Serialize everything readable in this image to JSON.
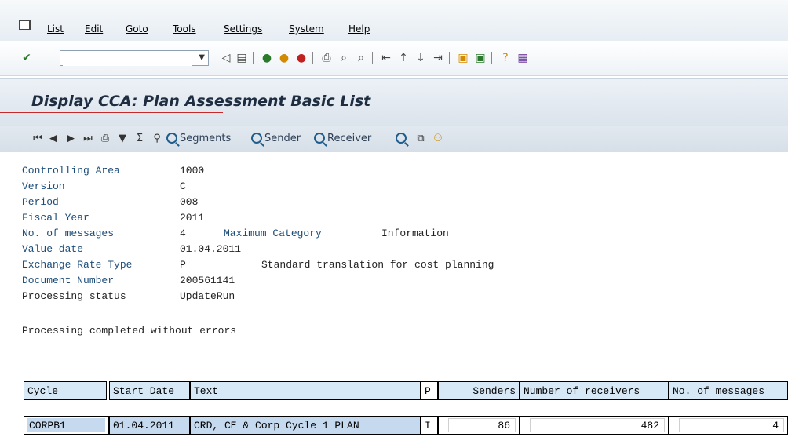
{
  "menubar": {
    "items": [
      "List",
      "Edit",
      "Goto",
      "Tools",
      "Settings",
      "System",
      "Help"
    ]
  },
  "toolbar": {
    "command_value": "",
    "icons": [
      "enter-icon",
      "back-icon",
      "save-icon",
      "back-green-icon",
      "exit-icon",
      "cancel-icon",
      "print-icon",
      "find-icon",
      "find-next-icon",
      "first-page-icon",
      "prev-page-icon",
      "next-page-icon",
      "last-page-icon",
      "new-session-icon",
      "shortcut-icon",
      "help-icon",
      "layout-icon"
    ]
  },
  "page": {
    "title": "Display CCA: Plan Assessment Basic List"
  },
  "apptoolbar": {
    "segments": "Segments",
    "sender": "Sender",
    "receiver": "Receiver"
  },
  "header": {
    "controlling_area_label": "Controlling Area",
    "controlling_area": "1000",
    "version_label": "Version",
    "version": "C",
    "period_label": "Period",
    "period": "008",
    "fiscal_year_label": "Fiscal Year",
    "fiscal_year": "2011",
    "messages_label": "No. of messages",
    "messages": "4",
    "max_category_label": "Maximum Category",
    "max_category": "Information",
    "value_date_label": "Value date",
    "value_date": "01.04.2011",
    "exch_label": "Exchange Rate Type",
    "exch": "P",
    "exch_text": "Standard translation for cost planning",
    "doc_label": "Document Number",
    "doc": "200561141",
    "status_label": "Processing status",
    "status": "UpdateRun",
    "result": "Processing completed without errors"
  },
  "table": {
    "columns": [
      "Cycle",
      "Start Date",
      "Text",
      "P",
      "Senders",
      "Number of receivers",
      "No. of messages"
    ],
    "rows": [
      {
        "cycle": "CORPB1",
        "start": "01.04.2011",
        "text": "CRD, CE & Corp Cycle 1 PLAN",
        "p": "I",
        "senders": "86",
        "receivers": "482",
        "messages": "4"
      }
    ]
  }
}
